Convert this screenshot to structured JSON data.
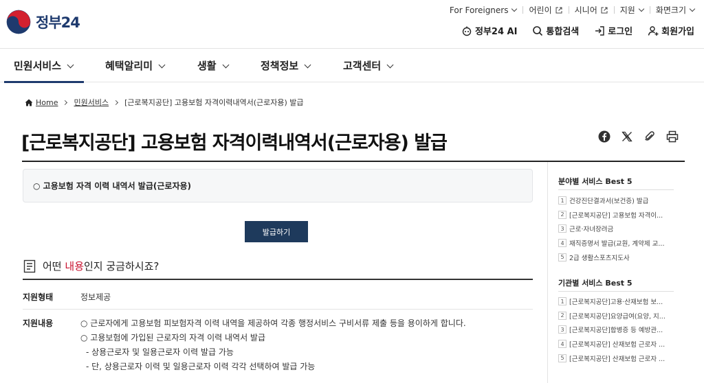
{
  "header": {
    "logo_text": "정부",
    "logo_num": "24",
    "util": [
      {
        "label": "For Foreigners",
        "kind": "dropdown"
      },
      {
        "label": "어린이",
        "kind": "external"
      },
      {
        "label": "시니어",
        "kind": "external"
      },
      {
        "label": "지원",
        "kind": "dropdown"
      },
      {
        "label": "화면크기",
        "kind": "dropdown"
      }
    ],
    "ai_label": "정부24 AI",
    "search_label": "통합검색",
    "login_label": "로그인",
    "signup_label": "회원가입"
  },
  "gnb": [
    "민원서비스",
    "혜택알리미",
    "생활",
    "정책정보",
    "고객센터"
  ],
  "breadcrumb": {
    "home": "Home",
    "level1": "민원서비스",
    "current": "[근로복지공단] 고용보험 자격이력내역서(근로자용) 발급"
  },
  "page_title": "[근로복지공단] 고용보험 자격이력내역서(근로자용) 발급",
  "service_box": "○ 고용보험 자격 이력 내역서 발급(근로자용)",
  "issue_button": "발급하기",
  "question": {
    "prefix": "어떤 ",
    "highlight": "내용",
    "suffix": "인지 궁금하시죠?"
  },
  "rows": {
    "type_label": "지원형태",
    "type_value": "정보제공",
    "content_label": "지원내용",
    "content_lines": [
      "○ 근로자에게 고용보험 피보험자격 이력 내역을 제공하여 각종 행정서비스 구비서류 제출 등을 용이하게 합니다.",
      "○ 고용보험에 가입된 근로자의 자격 이력 내역서 발급",
      "- 상용근로자 및 일용근로자 이력 발급 가능",
      "- 단, 상용근로자 이력 및 일용근로자 이력 각각 선택하여 발급 가능"
    ]
  },
  "sidebar": {
    "best_field_title": "분야별 서비스 Best 5",
    "best_field": [
      "건강진단결과서(보건증) 발급",
      "[근로복지공단] 고용보험 자격이...",
      "근로·자녀장려금",
      "재직증명서 발급(교원, 계약제 교...",
      "2급 생활스포츠지도사"
    ],
    "best_org_title": "기관별 서비스 Best 5",
    "best_org": [
      "[근로복지공단]고용·산재보험 보...",
      "[근로복지공단]요양급여(요양, 지...",
      "[근로복지공단]합병증 등 예방관...",
      "[근로복지공단] 산재보험 근로자 ...",
      "[근로복지공단] 산재보험 근로자 ..."
    ]
  },
  "colors": {
    "navy": "#1e3a6e",
    "button": "#1e3a5c",
    "accent_red": "#c8102e"
  }
}
